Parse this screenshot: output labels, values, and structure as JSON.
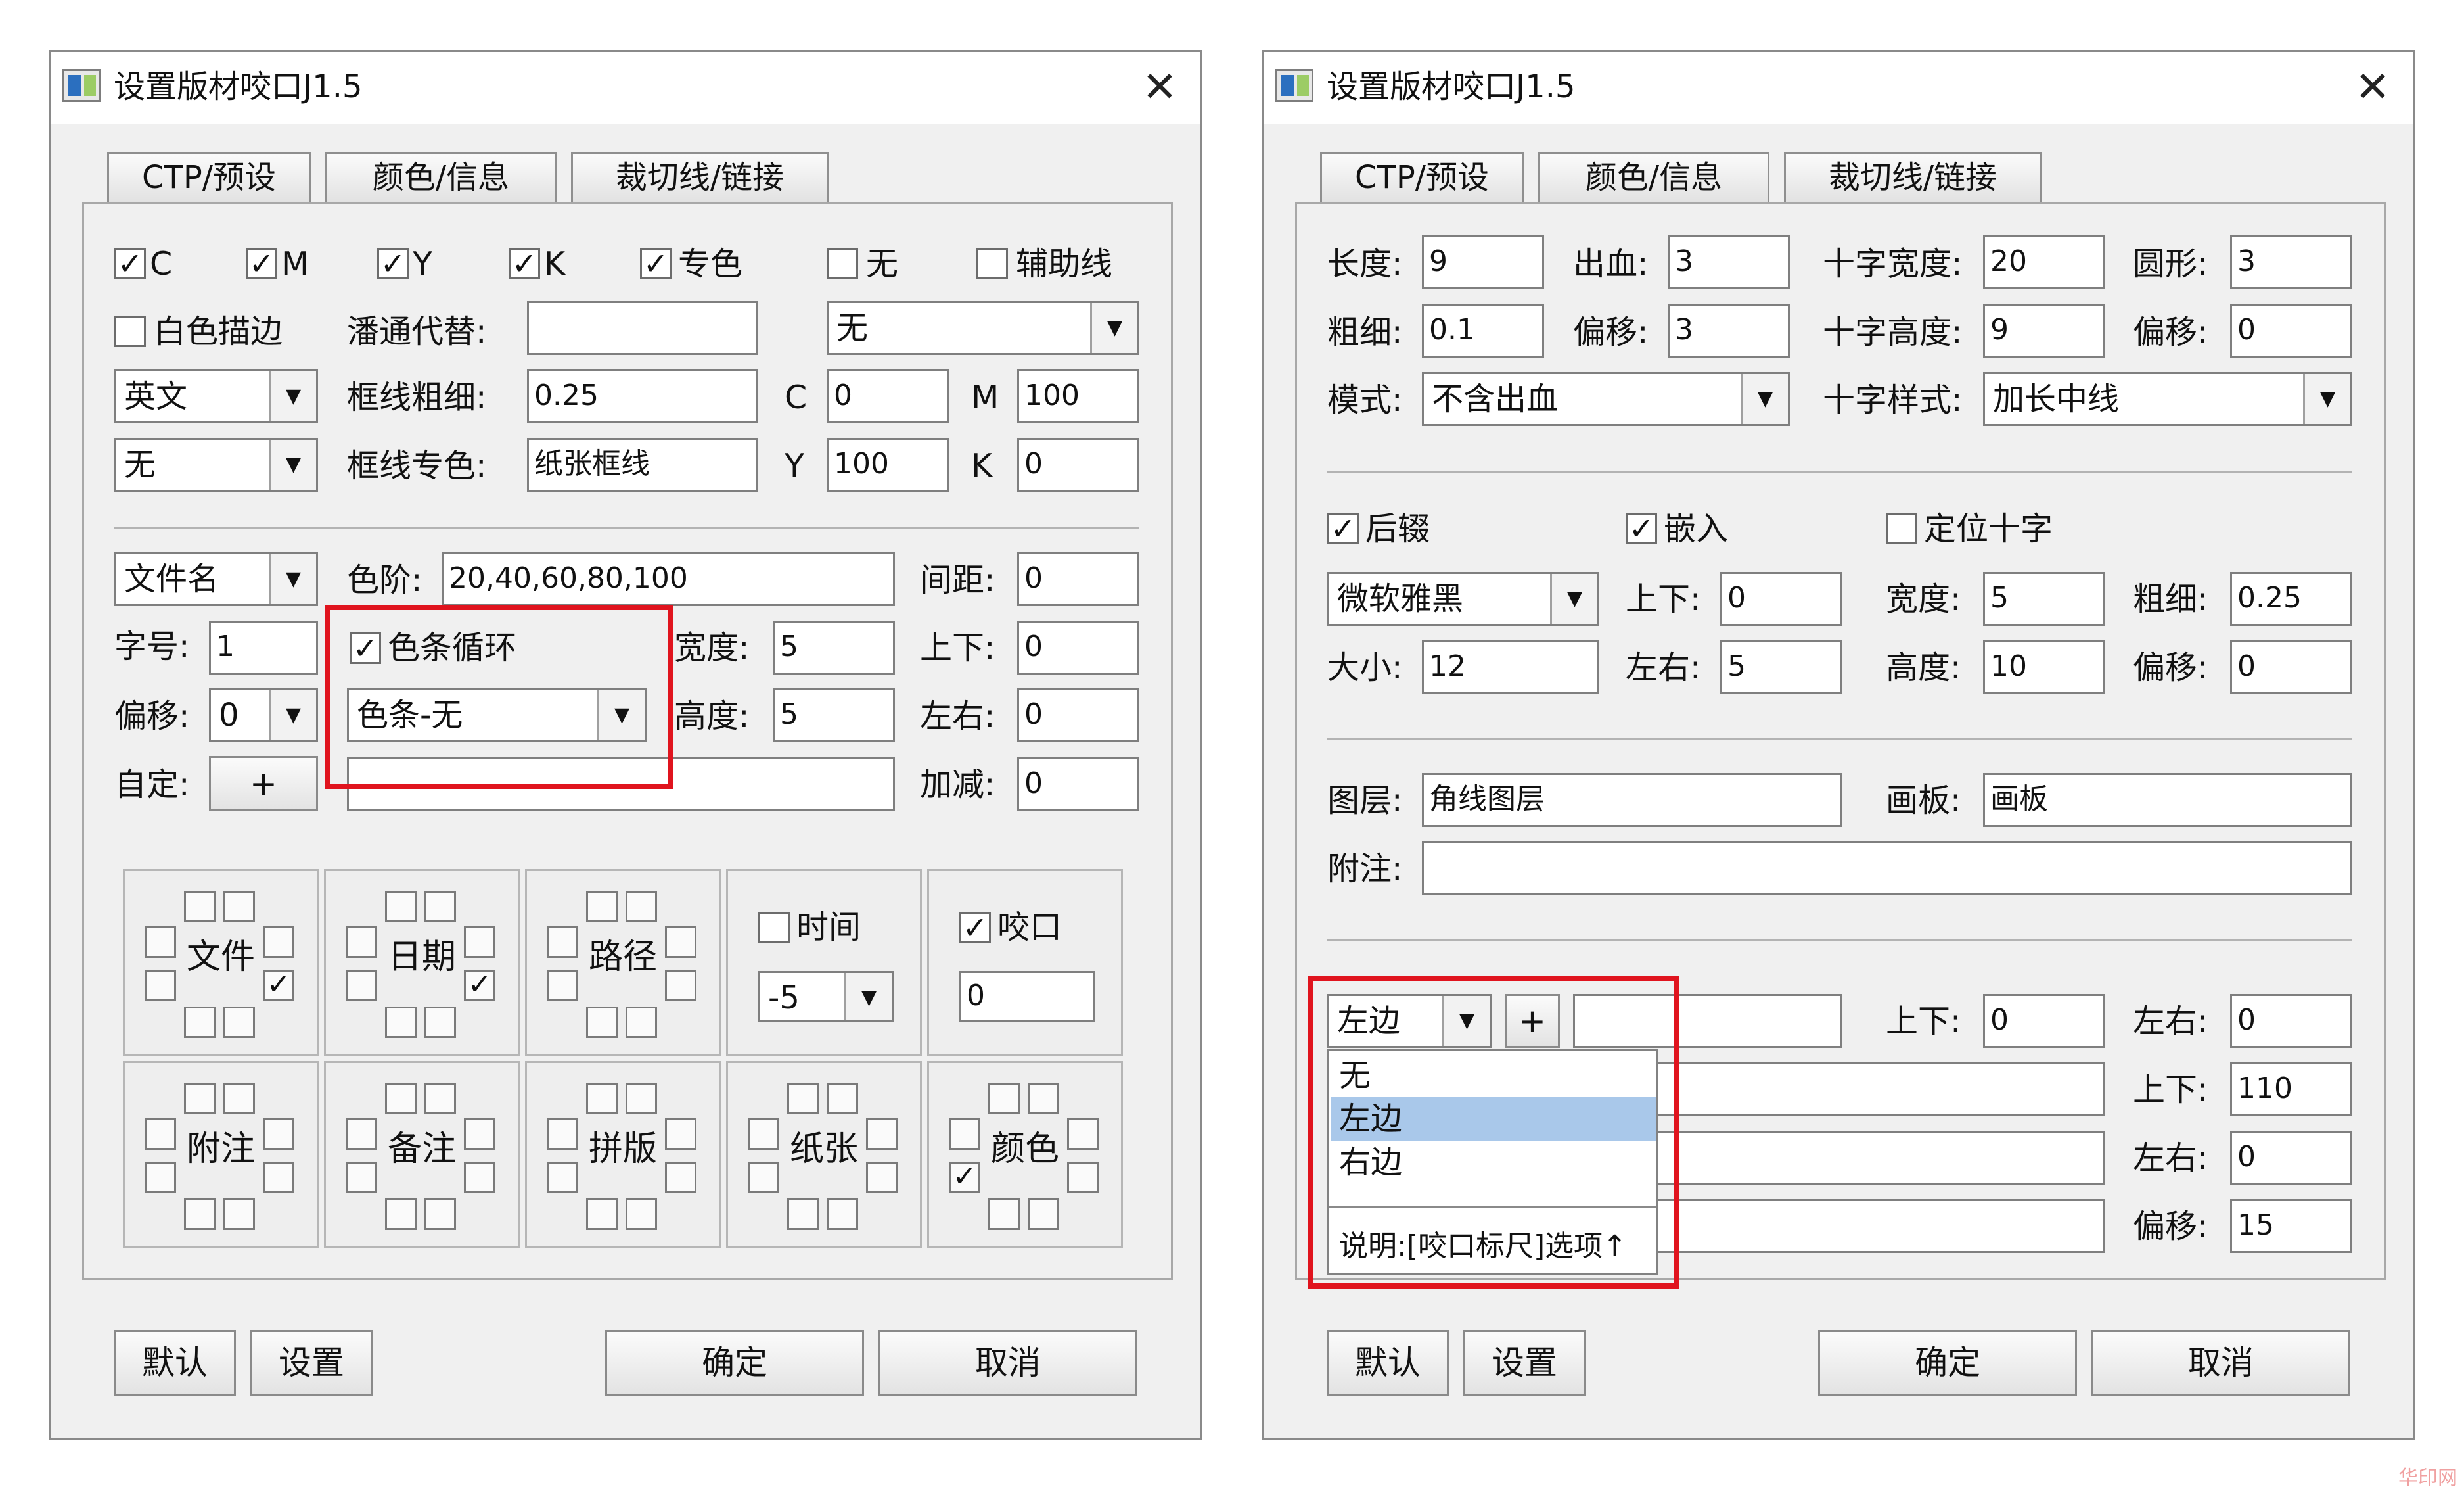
{
  "left_window": {
    "title": "设置版材咬口J1.5",
    "close_label": "✕",
    "tabs": [
      "CTP/预设",
      "颜色/信息",
      "裁切线/链接"
    ],
    "checks": [
      {
        "label": "C",
        "checked": true
      },
      {
        "label": "M",
        "checked": true
      },
      {
        "label": "Y",
        "checked": true
      },
      {
        "label": "K",
        "checked": true
      },
      {
        "label": "专色",
        "checked": true
      },
      {
        "label": "无",
        "checked": false
      },
      {
        "label": "辅助线",
        "checked": false
      }
    ],
    "white_stroke": {
      "label": "白色描边",
      "checked": false
    },
    "spot_sub": {
      "label": "潘通代替:",
      "value": ""
    },
    "select_none_top": "无",
    "lang_select": "英文",
    "frame_thick": {
      "label": "框线粗细:",
      "value": "0.25"
    },
    "c": {
      "label": "C",
      "value": "0"
    },
    "m": {
      "label": "M",
      "value": "100"
    },
    "select_none2": "无",
    "frame_spot": {
      "label": "框线专色:",
      "value": "纸张框线"
    },
    "y": {
      "label": "Y",
      "value": "100"
    },
    "k": {
      "label": "K",
      "value": "0"
    },
    "filename_select": "文件名",
    "levels": {
      "label": "色阶:",
      "value": "20,40,60,80,100"
    },
    "spacing": {
      "label": "间距:",
      "value": "0"
    },
    "font_size": {
      "label": "字号:",
      "value": "1"
    },
    "bar_loop": {
      "label": "色条循环",
      "checked": true
    },
    "bar_select": "色条-无",
    "width": {
      "label": "宽度:",
      "value": "5"
    },
    "updown": {
      "label": "上下:",
      "value": "0"
    },
    "offset": {
      "label": "偏移:",
      "value": "0"
    },
    "height": {
      "label": "高度:",
      "value": "5"
    },
    "leftright": {
      "label": "左右:",
      "value": "0"
    },
    "custom": {
      "label": "自定:",
      "button": "+",
      "value": ""
    },
    "addsub": {
      "label": "加减:",
      "value": "0"
    },
    "grid_cells": [
      {
        "text": "文件",
        "checked_square": true
      },
      {
        "text": "日期",
        "checked_square": true
      },
      {
        "text": "路径",
        "checked_square": false
      },
      {
        "text": "时间",
        "kind": "time",
        "checked": false,
        "select": "-5"
      },
      {
        "text": "咬口",
        "kind": "bite",
        "checked": true,
        "value": "0"
      },
      {
        "text": "附注",
        "checked_square": false
      },
      {
        "text": "备注",
        "checked_square": false
      },
      {
        "text": "拼版",
        "checked_square": false
      },
      {
        "text": "纸张",
        "checked_square": false
      },
      {
        "text": "颜色",
        "checked_square": true
      }
    ],
    "buttons": {
      "default": "默认",
      "settings": "设置",
      "ok": "确定",
      "cancel": "取消"
    }
  },
  "right_window": {
    "title": "设置版材咬口J1.5",
    "close_label": "✕",
    "tabs": [
      "CTP/预设",
      "颜色/信息",
      "裁切线/链接"
    ],
    "length": {
      "label": "长度:",
      "value": "9"
    },
    "bleed": {
      "label": "出血:",
      "value": "3"
    },
    "cross_width": {
      "label": "十字宽度:",
      "value": "20"
    },
    "circle": {
      "label": "圆形:",
      "value": "3"
    },
    "thick": {
      "label": "粗细:",
      "value": "0.1"
    },
    "offset1": {
      "label": "偏移:",
      "value": "3"
    },
    "cross_height": {
      "label": "十字高度:",
      "value": "9"
    },
    "offset2": {
      "label": "偏移:",
      "value": "0"
    },
    "mode": {
      "label": "模式:",
      "value": "不含出血"
    },
    "cross_style": {
      "label": "十字样式:",
      "value": "加长中线"
    },
    "suffix": {
      "label": "后辍",
      "checked": true
    },
    "embed": {
      "label": "嵌入",
      "checked": true
    },
    "locate_cross": {
      "label": "定位十字",
      "checked": false
    },
    "font_select": "微软雅黑",
    "ud1": {
      "label": "上下:",
      "value": "0"
    },
    "w1": {
      "label": "宽度:",
      "value": "5"
    },
    "thick2": {
      "label": "粗细:",
      "value": "0.25"
    },
    "size": {
      "label": "大小:",
      "value": "12"
    },
    "lr1": {
      "label": "左右:",
      "value": "5"
    },
    "h1": {
      "label": "高度:",
      "value": "10"
    },
    "offset3": {
      "label": "偏移:",
      "value": "0"
    },
    "layer": {
      "label": "图层:",
      "value": "角线图层"
    },
    "artboard": {
      "label": "画板:",
      "value": "画板"
    },
    "note": {
      "label": "附注:",
      "value": ""
    },
    "side_select": "左边",
    "plus": "+",
    "ud2": {
      "label": "上下:",
      "value": "0"
    },
    "lr2": {
      "label": "左右:",
      "value": "0"
    },
    "ud3": {
      "label": "上下:",
      "value": "110"
    },
    "lr3": {
      "label": "左右:",
      "value": "0"
    },
    "offset4": {
      "label": "偏移:",
      "value": "15"
    },
    "dropdown": {
      "items": [
        "无",
        "左边",
        "右边"
      ],
      "selected": "左边",
      "footer": "说明:[咬口标尺]选项↑"
    },
    "buttons": {
      "default": "默认",
      "settings": "设置",
      "ok": "确定",
      "cancel": "取消"
    }
  },
  "colors": {
    "highlight": "#e0141e",
    "selection": "#a9c8ea",
    "window_bg": "#f0f0f0"
  },
  "watermark": "华印网"
}
